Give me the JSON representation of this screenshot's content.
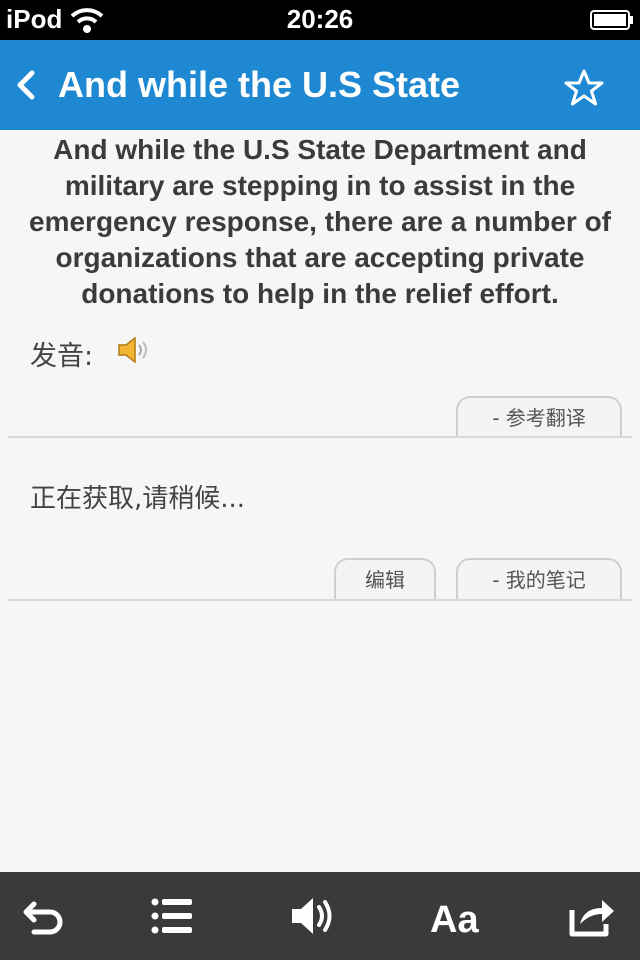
{
  "status_bar": {
    "carrier": "iPod",
    "time": "20:26"
  },
  "nav": {
    "title": "And while the U.S State"
  },
  "sentence": {
    "lines": [
      "And while the U.S State Department and",
      "military are stepping in to assist in the",
      "emergency response, there are a number of",
      "organizations that are accepting private",
      "donations to help in the relief effort."
    ]
  },
  "pronunciation_label": "发音:",
  "buttons": {
    "reference_translation": "- 参考翻译",
    "edit": "编辑",
    "my_notes": "- 我的笔记"
  },
  "translation_status": "正在获取,请稍候...",
  "icons": {
    "back": "chevron-left-icon",
    "favorite": "star-outline-icon",
    "speaker": "speaker-icon",
    "toolbar": [
      "undo-icon",
      "list-icon",
      "speaker-icon",
      "font-size-icon",
      "share-icon"
    ]
  },
  "colors": {
    "nav": "#1e88d3",
    "toolbar": "#3a3a3a",
    "background": "#f6f6f6"
  }
}
